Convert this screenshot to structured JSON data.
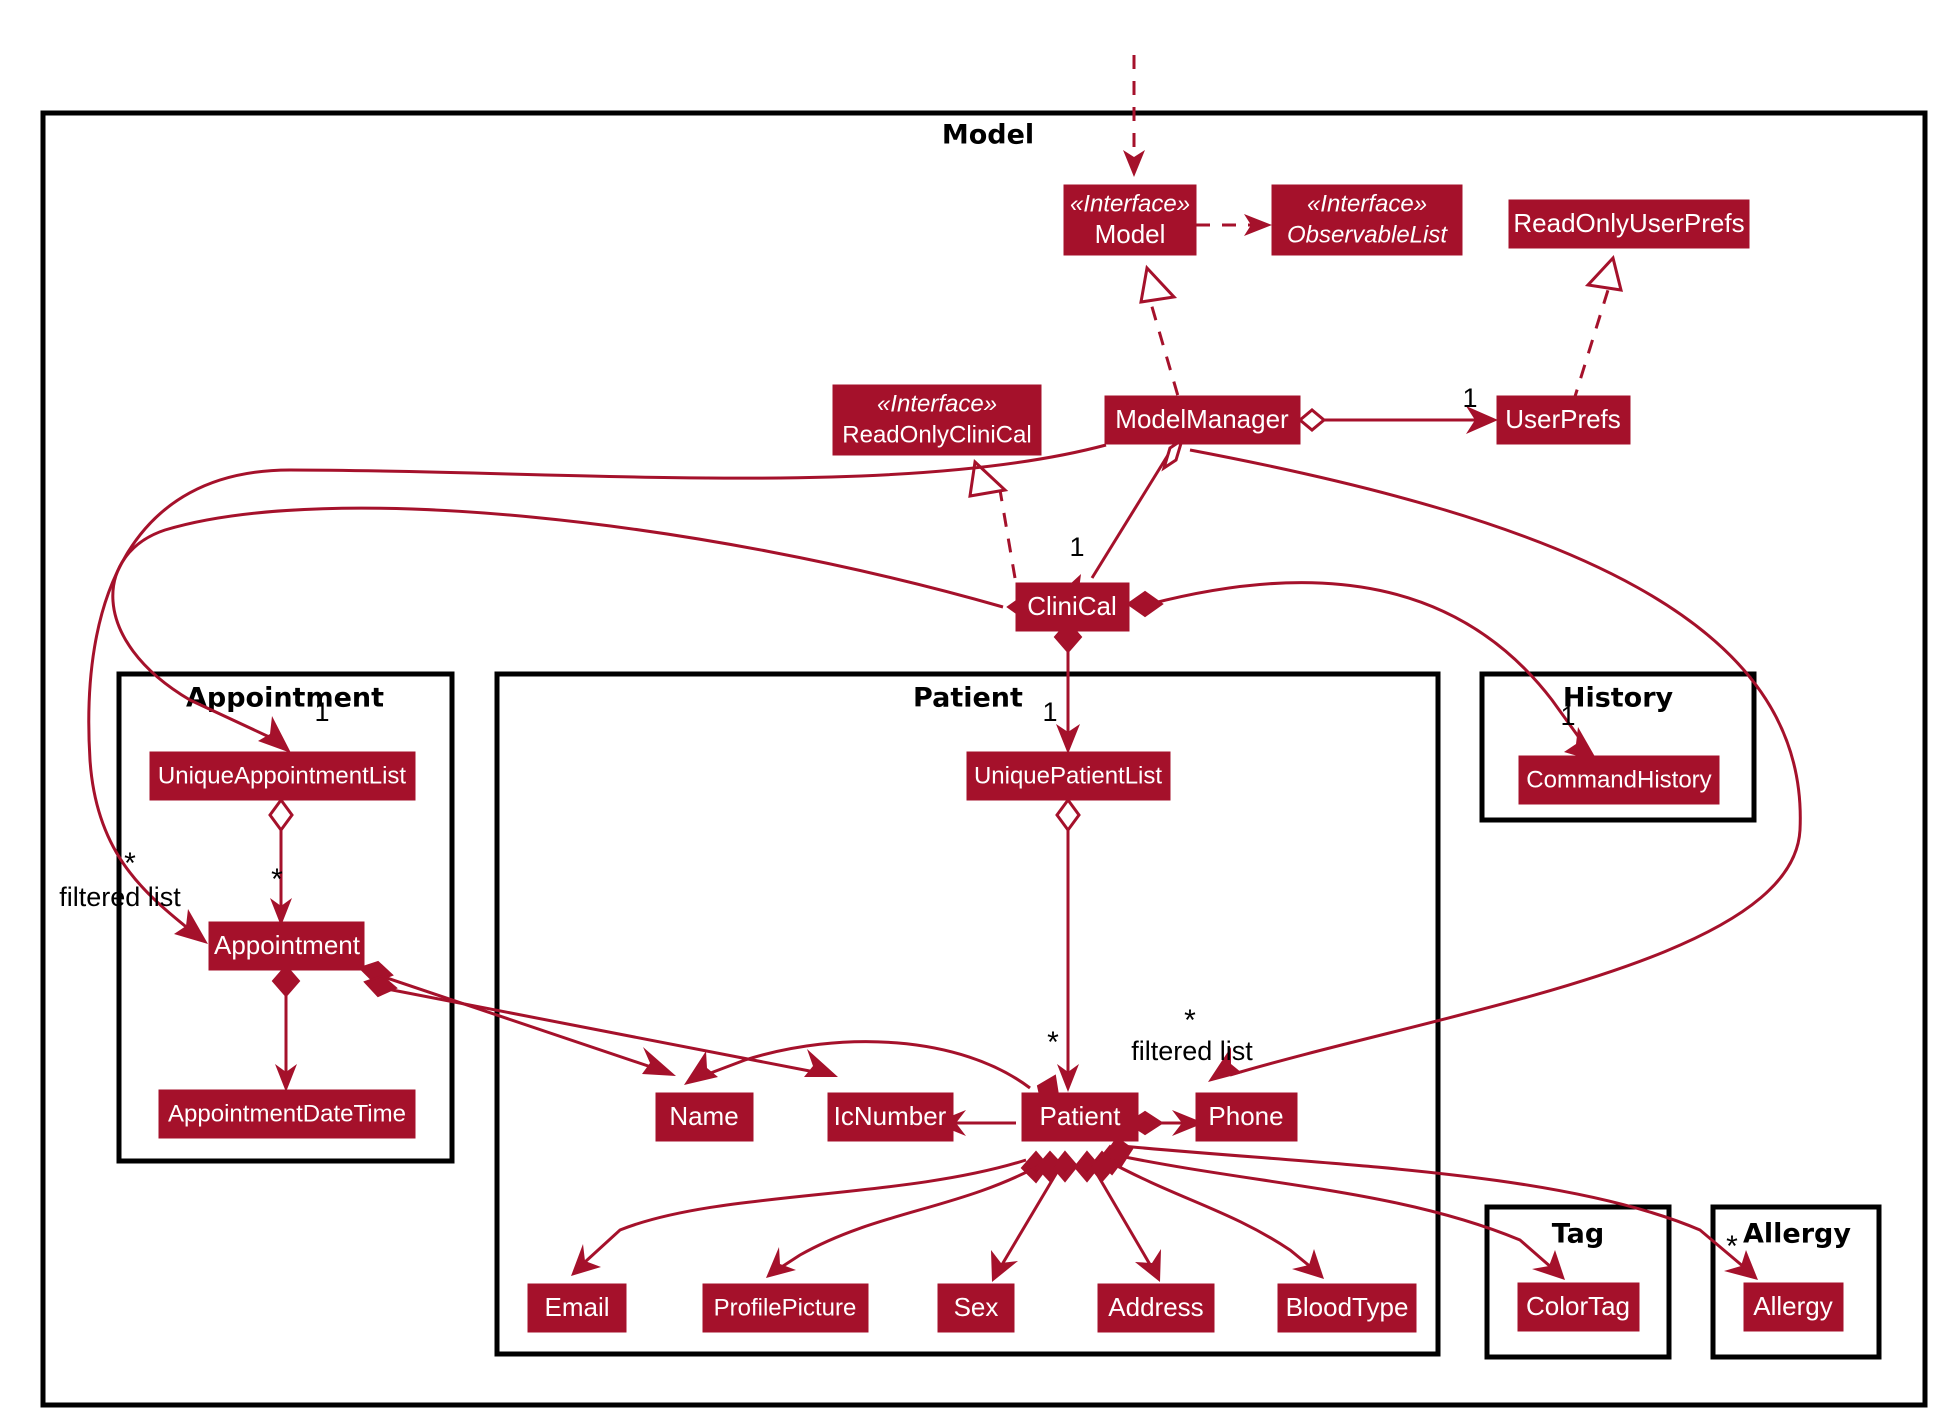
{
  "diagram": {
    "title": "Model",
    "type": "uml-class-diagram",
    "accent_color": "#A5112B",
    "frame_color": "#000000",
    "background": "#ffffff"
  },
  "packages": [
    {
      "id": "model",
      "label": "Model"
    },
    {
      "id": "appointment",
      "label": "Appointment"
    },
    {
      "id": "patient",
      "label": "Patient"
    },
    {
      "id": "history",
      "label": "History"
    },
    {
      "id": "tag",
      "label": "Tag"
    },
    {
      "id": "allergy",
      "label": "Allergy"
    }
  ],
  "classes": [
    {
      "id": "model_iface",
      "stereotype": "«Interface»",
      "name": "Model",
      "italic": true
    },
    {
      "id": "observable_list",
      "stereotype": "«Interface»",
      "name": "ObservableList",
      "italic": true
    },
    {
      "id": "readonly_userprefs",
      "stereotype": "",
      "name": "ReadOnlyUserPrefs",
      "italic": false
    },
    {
      "id": "readonly_clinical",
      "stereotype": "«Interface»",
      "name": "ReadOnlyCliniCal",
      "italic": false
    },
    {
      "id": "model_manager",
      "stereotype": "",
      "name": "ModelManager",
      "italic": false
    },
    {
      "id": "user_prefs",
      "stereotype": "",
      "name": "UserPrefs",
      "italic": false
    },
    {
      "id": "clinical",
      "stereotype": "",
      "name": "CliniCal",
      "italic": false
    },
    {
      "id": "unique_appt_list",
      "stereotype": "",
      "name": "UniqueAppointmentList",
      "italic": false
    },
    {
      "id": "appointment",
      "stereotype": "",
      "name": "Appointment",
      "italic": false
    },
    {
      "id": "appt_datetime",
      "stereotype": "",
      "name": "AppointmentDateTime",
      "italic": false
    },
    {
      "id": "unique_patient_list",
      "stereotype": "",
      "name": "UniquePatientList",
      "italic": false
    },
    {
      "id": "name",
      "stereotype": "",
      "name": "Name",
      "italic": false
    },
    {
      "id": "icnumber",
      "stereotype": "",
      "name": "IcNumber",
      "italic": false
    },
    {
      "id": "patient",
      "stereotype": "",
      "name": "Patient",
      "italic": false
    },
    {
      "id": "phone",
      "stereotype": "",
      "name": "Phone",
      "italic": false
    },
    {
      "id": "email",
      "stereotype": "",
      "name": "Email",
      "italic": false
    },
    {
      "id": "profile_picture",
      "stereotype": "",
      "name": "ProfilePicture",
      "italic": false
    },
    {
      "id": "sex",
      "stereotype": "",
      "name": "Sex",
      "italic": false
    },
    {
      "id": "address",
      "stereotype": "",
      "name": "Address",
      "italic": false
    },
    {
      "id": "bloodtype",
      "stereotype": "",
      "name": "BloodType",
      "italic": false
    },
    {
      "id": "command_history",
      "stereotype": "",
      "name": "CommandHistory",
      "italic": false
    },
    {
      "id": "colortag",
      "stereotype": "",
      "name": "ColorTag",
      "italic": false
    },
    {
      "id": "allergy",
      "stereotype": "",
      "name": "Allergy",
      "italic": false
    }
  ],
  "multiplicities": {
    "userprefs_one": "1",
    "clinical_one": "1",
    "unique_appt_list_one": "1",
    "unique_patient_list_one": "1",
    "command_history_one": "1",
    "appointment_star": "*",
    "appointment_filtered_star": "*",
    "patient_star": "*",
    "patient_filtered_star": "*",
    "allergy_star": "*"
  },
  "edge_labels": {
    "filtered_list_appointment": "filtered list",
    "filtered_list_patient": "filtered list"
  }
}
